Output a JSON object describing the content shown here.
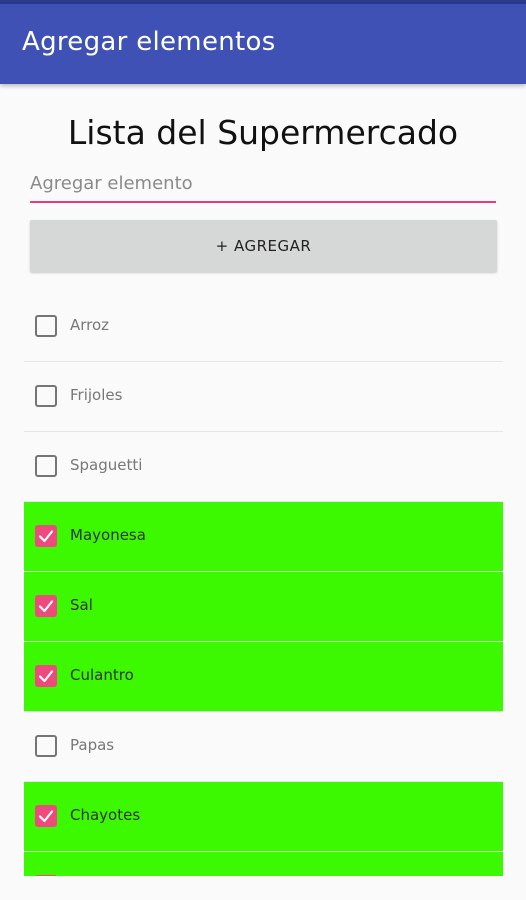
{
  "app_bar": {
    "title": "Agregar elementos",
    "color": "#3f51b5"
  },
  "main": {
    "heading": "Lista del Supermercado",
    "input_placeholder": "Agregar elemento",
    "input_value": "",
    "add_button_label": "+ AGREGAR"
  },
  "colors": {
    "checked_row": "#3cf800",
    "checkbox_accent": "#ef4a7e"
  },
  "list": {
    "items": [
      {
        "label": "Arroz",
        "checked": false
      },
      {
        "label": "Frijoles",
        "checked": false
      },
      {
        "label": "Spaguetti",
        "checked": false
      },
      {
        "label": "Mayonesa",
        "checked": true
      },
      {
        "label": "Sal",
        "checked": true
      },
      {
        "label": "Culantro",
        "checked": true
      },
      {
        "label": "Papas",
        "checked": false
      },
      {
        "label": "Chayotes",
        "checked": true
      },
      {
        "label": "",
        "checked": true
      }
    ]
  }
}
